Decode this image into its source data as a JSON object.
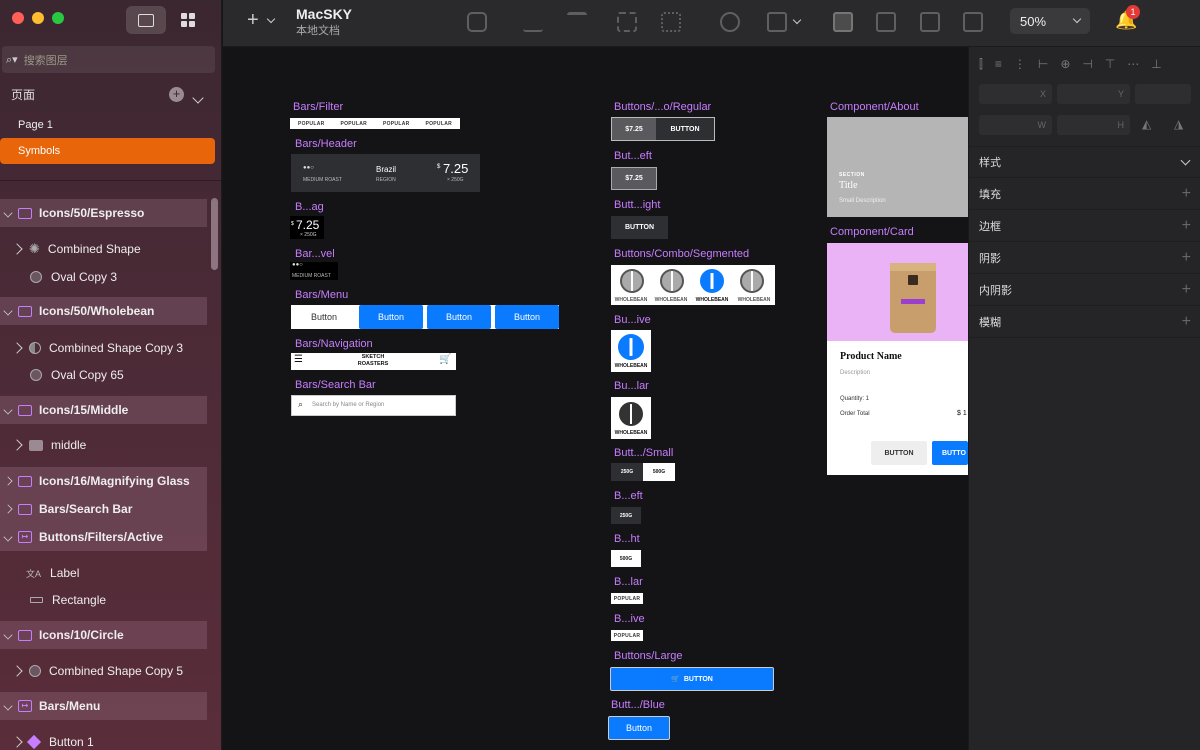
{
  "app": {
    "title": "MacSKY",
    "subtitle": "本地文档"
  },
  "sidebar": {
    "search_placeholder": "搜索图层",
    "pages_label": "页面",
    "pages": [
      {
        "label": "Page 1"
      },
      {
        "label": "Symbols"
      }
    ],
    "layers": [
      {
        "label": "Icons/50/Espresso"
      },
      {
        "label": "Combined Shape"
      },
      {
        "label": "Oval Copy 3"
      },
      {
        "label": "Icons/50/Wholebean"
      },
      {
        "label": "Combined Shape Copy 3"
      },
      {
        "label": "Oval Copy 65"
      },
      {
        "label": "Icons/15/Middle"
      },
      {
        "label": "middle"
      },
      {
        "label": "Icons/16/Magnifying Glass"
      },
      {
        "label": "Bars/Search Bar"
      },
      {
        "label": "Buttons/Filters/Active"
      },
      {
        "label": "Label"
      },
      {
        "label": "Rectangle"
      },
      {
        "label": "Icons/10/Circle"
      },
      {
        "label": "Combined Shape Copy 5"
      },
      {
        "label": "Bars/Menu"
      },
      {
        "label": "Button 1"
      }
    ]
  },
  "toolbar": {
    "zoom": "50%",
    "notifications": "1"
  },
  "artboards": {
    "filter": "Bars/Filter",
    "filter_items": [
      "POPULAR",
      "POPULAR",
      "POPULAR",
      "POPULAR"
    ],
    "header": "Bars/Header",
    "header_roast": "MEDIUM ROAST",
    "header_country": "Brazil",
    "header_region": "REGION",
    "header_price_cur": "$",
    "header_price": "7.25",
    "header_weight": "× 250G",
    "bag": "B...ag",
    "bag_price_cur": "$",
    "bag_price": "7.25",
    "bag_weight": "× 250G",
    "level": "Bar...vel",
    "level_roast": "MEDIUM ROAST",
    "menu": "Bars/Menu",
    "menu_items": [
      "Button",
      "Button",
      "Button",
      "Button"
    ],
    "navigation": "Bars/Navigation",
    "nav_title": "SKETCH ROASTERS",
    "search": "Bars/Search Bar",
    "search_placeholder": "Search by Name or Region",
    "btn_regular": "Buttons/...o/Regular",
    "btn_regular_price": "$7.25",
    "btn_regular_label": "BUTTON",
    "btn_left": "But...eft",
    "btn_left_price": "$7.25",
    "btn_right": "Butt...ight",
    "btn_right_label": "BUTTON",
    "segmented": "Buttons/Combo/Segmented",
    "seg_labels": [
      "WHOLEBEAN",
      "WHOLEBEAN",
      "WHOLEBEAN",
      "WHOLEBEAN"
    ],
    "active": "Bu...ive",
    "active_label": "WHOLEBEAN",
    "regular": "Bu...lar",
    "regular_label": "WHOLEBEAN",
    "small": "Butt.../Small",
    "small_a": "250G",
    "small_b": "500G",
    "small_left": "B...eft",
    "small_left_label": "250G",
    "small_right": "B...ht",
    "small_right_label": "500G",
    "filter_regular": "B...lar",
    "filter_regular_label": "POPULAR",
    "filter_active": "B...ive",
    "filter_active_label": "POPULAR",
    "large": "Buttons/Large",
    "large_label": "BUTTON",
    "blue": "Butt.../Blue",
    "blue_label": "Button",
    "about": "Component/About",
    "about_section": "SECTION",
    "about_title": "Title",
    "about_desc": "Small Description",
    "card": "Component/Card",
    "card_product": "Product Name",
    "card_desc": "Description",
    "card_qty": "Quantity: 1",
    "card_total": "Order Total",
    "card_total_val": "$ 1",
    "card_btn1": "BUTTON",
    "card_btn2": "BUTTO"
  },
  "inspector": {
    "x": "X",
    "y": "Y",
    "w": "W",
    "h": "H",
    "style": "样式",
    "rows": [
      "填充",
      "边框",
      "阴影",
      "内阴影",
      "模糊"
    ]
  },
  "colors": {
    "accent": "#c77dff",
    "selected": "#e8650a",
    "blue": "#0a7aff"
  }
}
